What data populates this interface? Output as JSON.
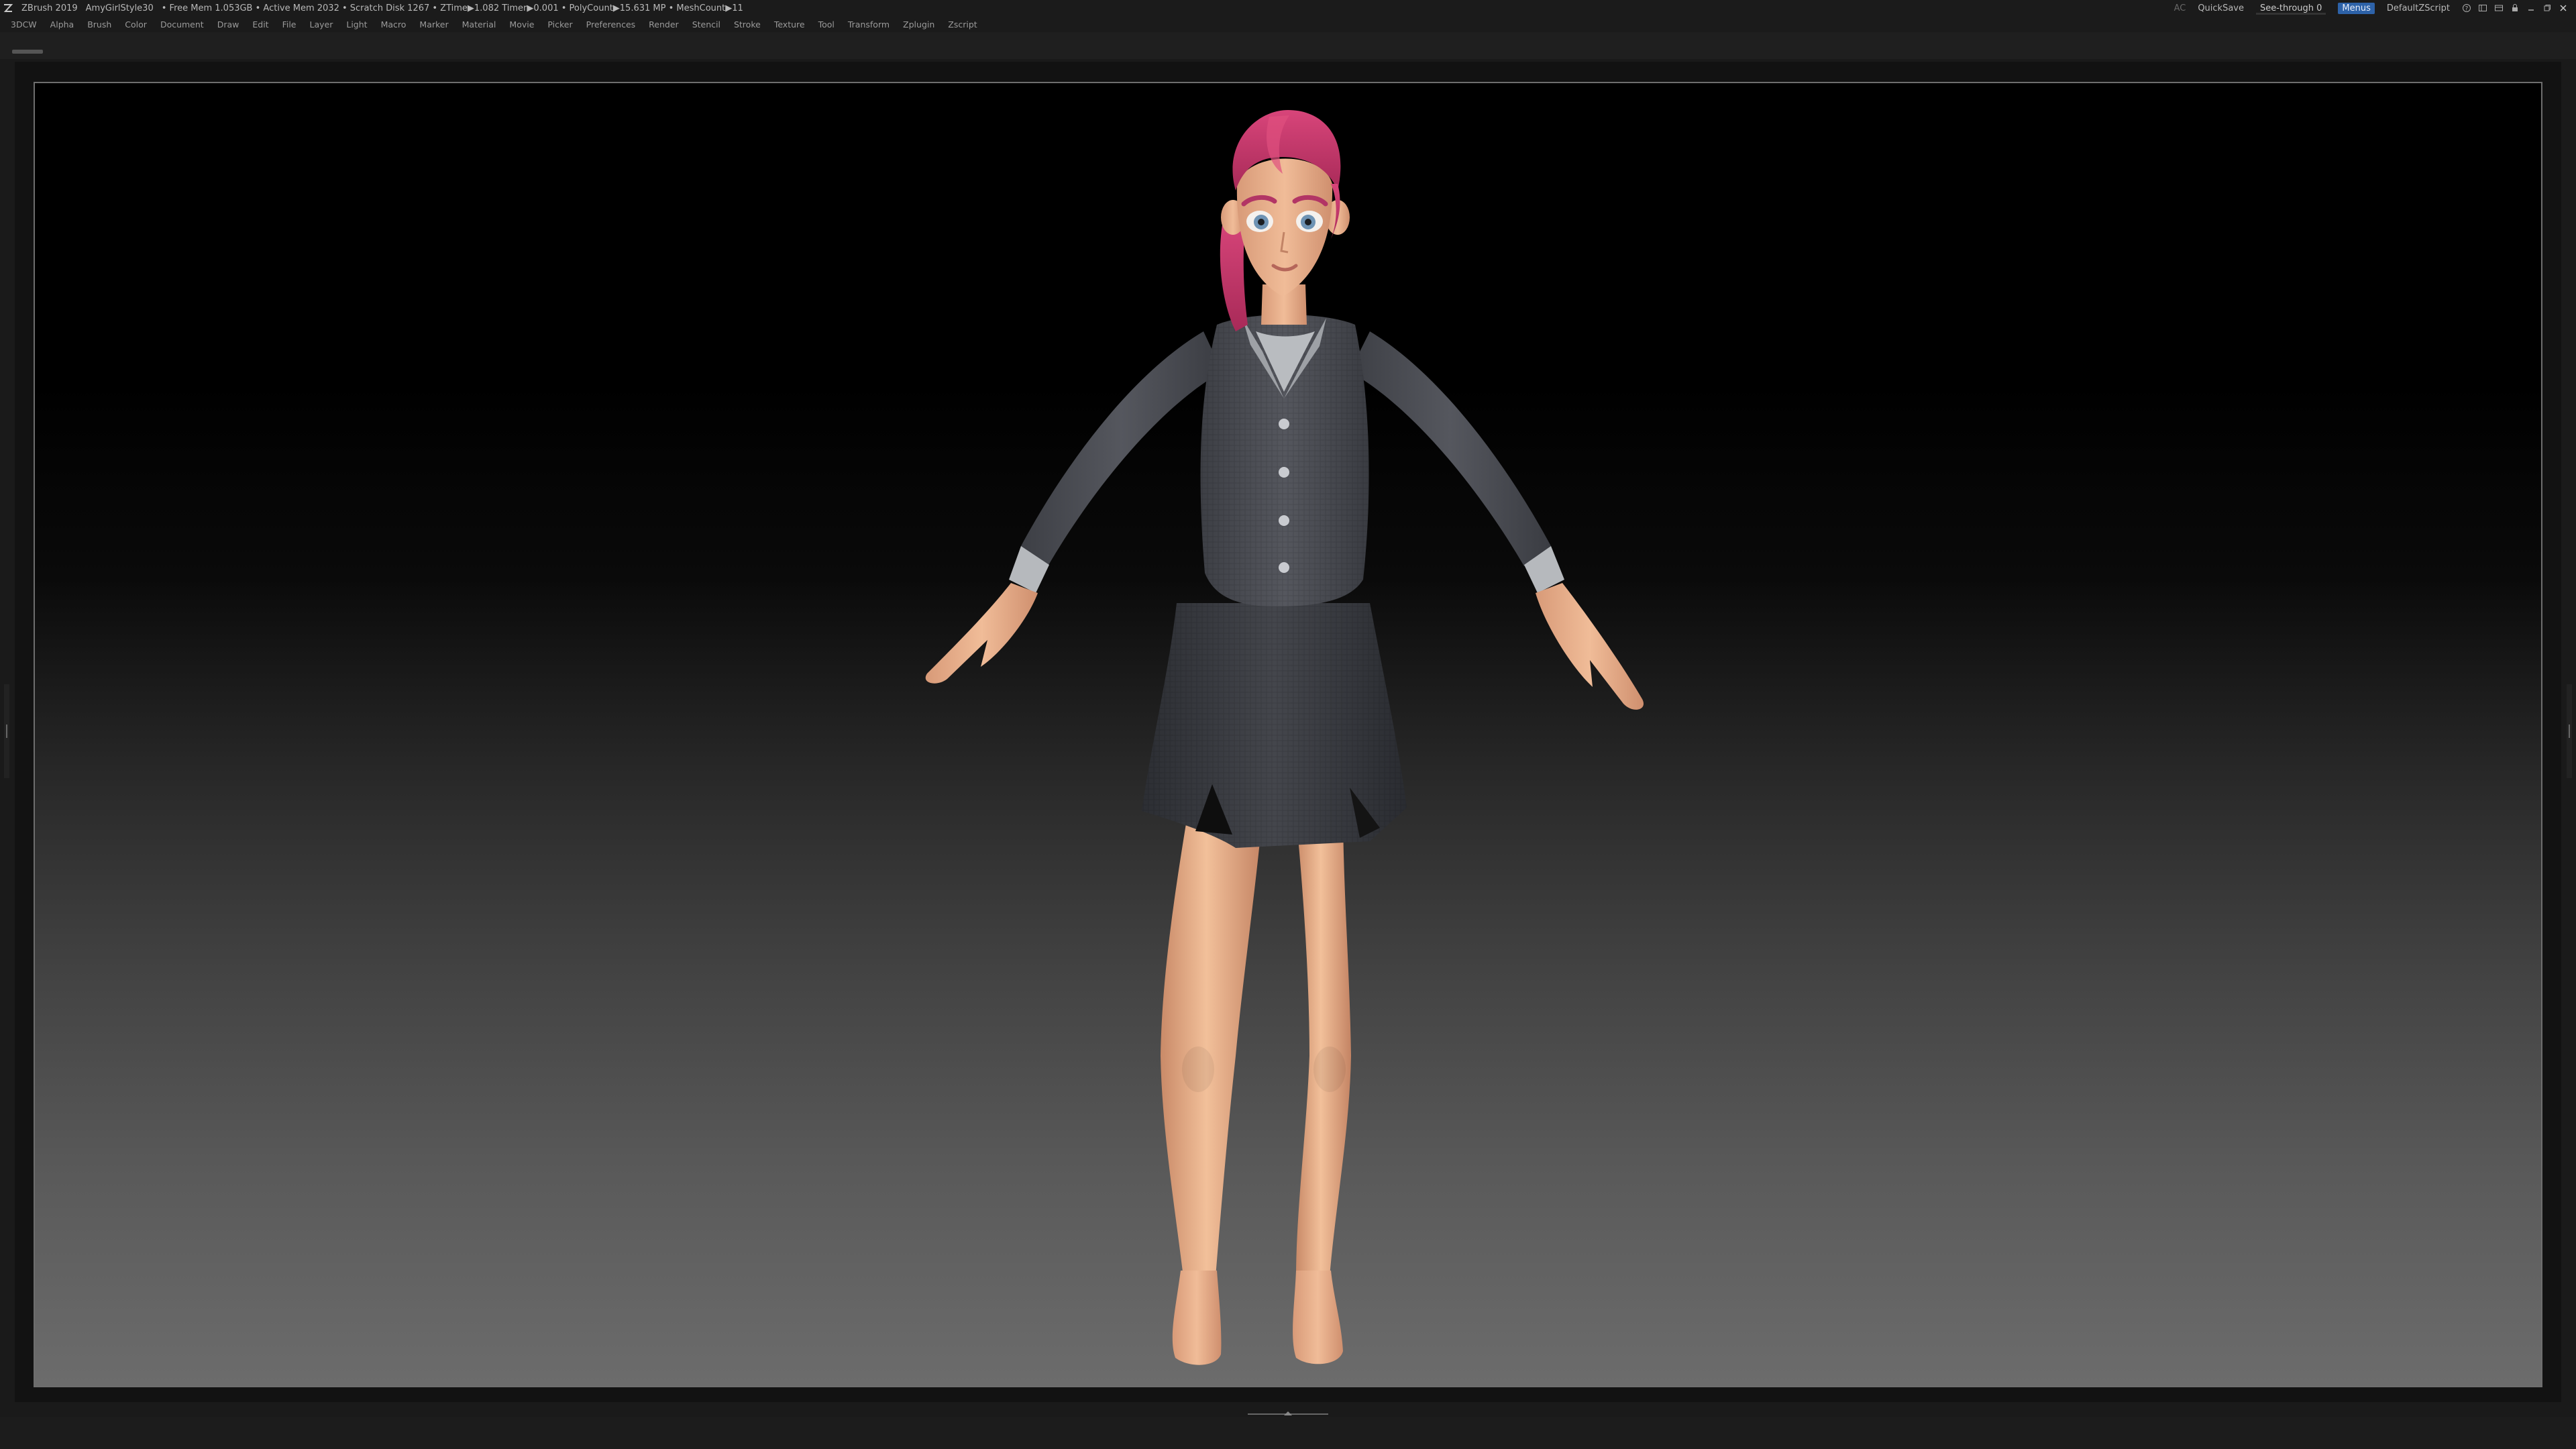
{
  "titlebar": {
    "app": "ZBrush 2019",
    "project": "AmyGirlStyle30",
    "stats": "• Free Mem 1.053GB • Active Mem 2032 • Scratch Disk 1267 • ZTime▶1.082 Timer▶0.001 • PolyCount▶15.631 MP • MeshCount▶11",
    "ac_label": "AC",
    "quicksave": "QuickSave",
    "see_through": "See-through 0",
    "see_through_value": 0,
    "menus_badge": "Menus",
    "script": "DefaultZScript"
  },
  "menubar": {
    "items": [
      "3DCW",
      "Alpha",
      "Brush",
      "Color",
      "Document",
      "Draw",
      "Edit",
      "File",
      "Layer",
      "Light",
      "Macro",
      "Marker",
      "Material",
      "Movie",
      "Picker",
      "Preferences",
      "Render",
      "Stencil",
      "Stroke",
      "Texture",
      "Tool",
      "Transform",
      "Zplugin",
      "Zscript"
    ]
  },
  "icons": {
    "app": "zbrush-logo-icon",
    "window_controls": [
      "help-icon",
      "layout-icon",
      "palette-icon",
      "lock-icon",
      "minimize-icon",
      "restore-icon",
      "close-icon"
    ]
  },
  "colors": {
    "hair": "#c8366a",
    "skin": "#e8b08c",
    "jacket": "#4a4c52",
    "skirt": "#3c3e44",
    "shirt": "#b9bcc0",
    "accent_menu": "#2d62a8",
    "slider_accent": "#e8a020"
  }
}
